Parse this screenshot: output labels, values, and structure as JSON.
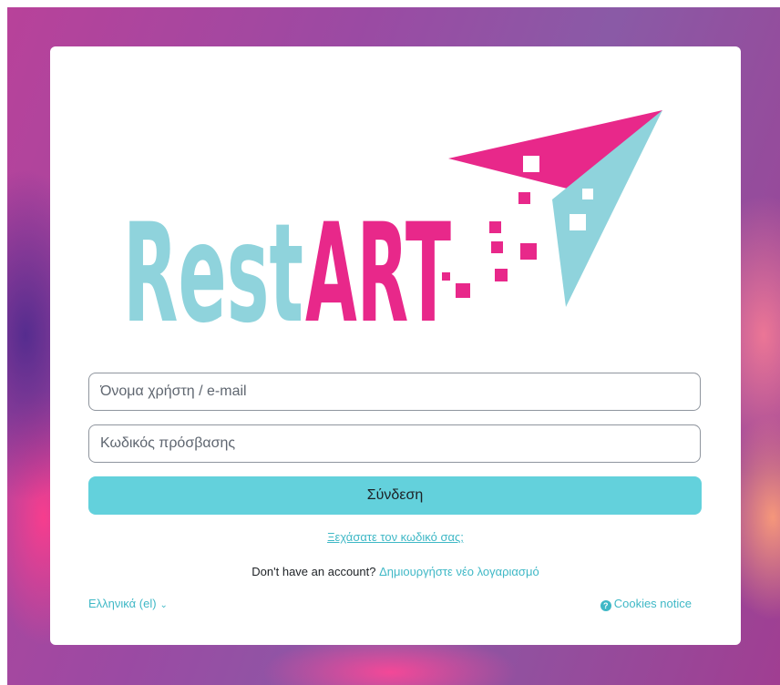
{
  "brand": {
    "logo_rest": "Rest",
    "logo_art": "ART",
    "color_teal": "#8fd3dc",
    "color_pink": "#e8288a"
  },
  "login": {
    "username_placeholder": "Όνομα χρήστη / e-mail",
    "password_placeholder": "Κωδικός πρόσβασης",
    "submit_label": "Σύνδεση",
    "forgot_link": "Ξεχάσατε τον κωδικό σας;",
    "no_account_text": "Don't have an account?",
    "signup_link": "Δημιουργήστε νέο λογαριασμό"
  },
  "footer": {
    "language_label": "Ελληνικά (el)",
    "language_icon": "chevron-down-icon",
    "cookies_label": "Cookies notice",
    "cookies_icon": "question-circle-icon"
  },
  "colors": {
    "accent": "#63d1dc",
    "link": "#3fb8c6"
  }
}
